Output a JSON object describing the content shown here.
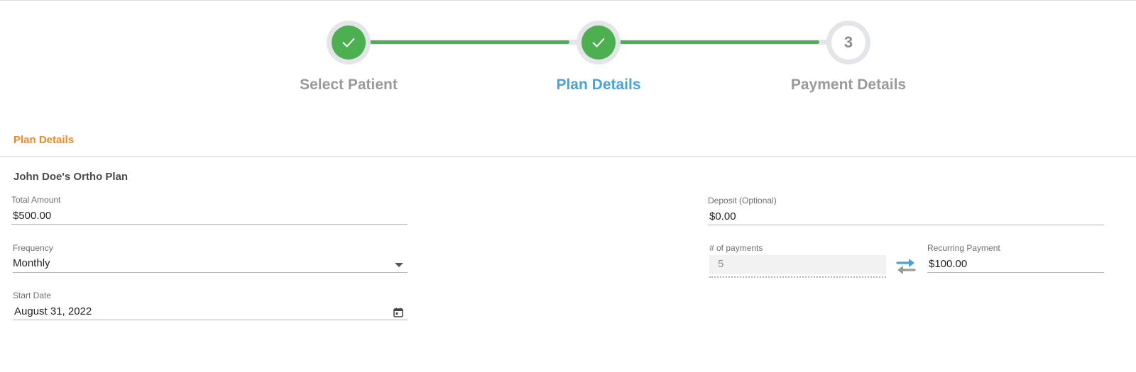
{
  "stepper": {
    "steps": [
      {
        "label": "Select Patient",
        "status": "complete",
        "icon": "check-icon"
      },
      {
        "label": "Plan Details",
        "status": "active",
        "icon": "check-icon"
      },
      {
        "label": "Payment Details",
        "status": "pending",
        "number": "3"
      }
    ],
    "colors": {
      "complete": "#4caf50",
      "active_label": "#4aa3d8",
      "inactive_label": "#9a9a9a",
      "track": "#e3e5e8"
    }
  },
  "section": {
    "title": "Plan Details",
    "title_color": "#e9892a",
    "plan_name": "John Doe's Ortho Plan"
  },
  "form": {
    "total_amount": {
      "label": "Total Amount",
      "value": "$500.00"
    },
    "frequency": {
      "label": "Frequency",
      "value": "Monthly",
      "icon": "chevron-down-icon"
    },
    "start_date": {
      "label": "Start Date",
      "value": "August 31, 2022",
      "icon": "calendar-icon"
    },
    "deposit": {
      "label": "Deposit (Optional)",
      "value": "$0.00"
    },
    "num_payments": {
      "label": "# of payments",
      "value": "5",
      "disabled": true
    },
    "recurring_payment": {
      "label": "Recurring Payment",
      "value": "$100.00"
    },
    "swap_icon": {
      "name": "swap-arrows-icon",
      "colors": [
        "#4aa3d8",
        "#9a9a9a"
      ]
    }
  }
}
